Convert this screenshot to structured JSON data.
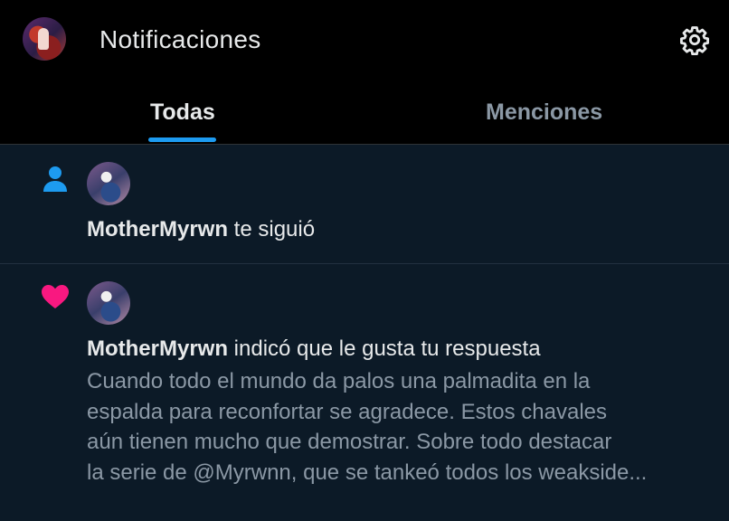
{
  "header": {
    "title": "Notificaciones",
    "profile_icon": "profile-avatar",
    "settings_icon": "gear-icon"
  },
  "tabs": [
    {
      "label": "Todas",
      "active": true
    },
    {
      "label": "Menciones",
      "active": false
    }
  ],
  "colors": {
    "accent": "#1d9bf0",
    "follow_icon": "#1d9bf0",
    "like_icon": "#f91880",
    "feed_background": "#0c1a27"
  },
  "notifications": [
    {
      "type_icon": "person-icon",
      "user": "MotherMyrwn",
      "action": "te siguió"
    },
    {
      "type_icon": "heart-icon",
      "user": "MotherMyrwn",
      "action": "indicó que le gusta tu respuesta",
      "quote_lines": [
        "Cuando todo el mundo da palos una palmadita en la",
        "espalda para reconfortar se agradece. Estos chavales",
        "aún tienen mucho que demostrar. Sobre todo destacar",
        "la serie de @Myrwnn, que se tankeó todos los weakside..."
      ]
    }
  ]
}
